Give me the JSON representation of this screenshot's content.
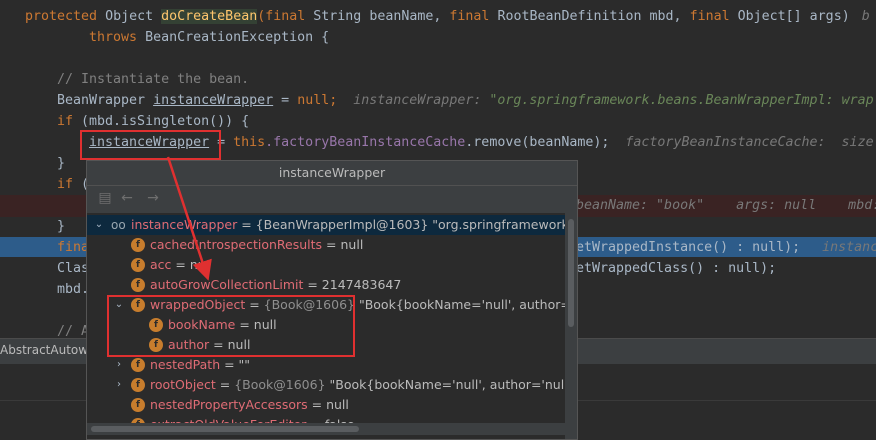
{
  "code": {
    "line1": {
      "kw": "protected",
      "type": "Object",
      "method": "doCreateBean",
      "params_a": "(final",
      "params_b": "String beanName,",
      "params_c": "final",
      "params_d": "RootBeanDefinition mbd,",
      "params_e": "final",
      "params_f": "Object[] args)",
      "trail": "b"
    },
    "line2": {
      "kw": "throws",
      "rest": "BeanCreationException {"
    },
    "line3": {
      "comment": "// Instantiate the bean."
    },
    "line4": {
      "code_a": "BeanWrapper",
      "code_b": "instanceWrapper",
      "code_c": " = ",
      "kw": "null",
      "code_d": ";",
      "hint_a": "instanceWrapper: ",
      "hint_b": "\"org.springframework.beans.BeanWrapperImpl: wrap"
    },
    "line5": {
      "kw": "if",
      "rest": " (mbd.isSingleton()) {"
    },
    "line6": {
      "var": "instanceWrapper",
      "eq": " = ",
      "kw": "this",
      "field": ".factoryBeanInstanceCache",
      "rest": ".remove(beanName);",
      "hint": "factoryBeanInstanceCache:  size"
    },
    "line7": {
      "text": "}"
    },
    "line8": {
      "kw": "if",
      "rest": " ("
    },
    "line9": {
      "hint": "beanName: \"book\"    args: null    mbd:"
    },
    "line10": {
      "text": "}"
    },
    "line11": {
      "start": "fina",
      "rest": "etWrappedInstance() : null);",
      "hint": "instance"
    },
    "line12": {
      "start": "Clas",
      "rest": "etWrappedClass() : null);"
    },
    "line13": {
      "start": "mbd."
    },
    "line14": {
      "start": "// A"
    }
  },
  "bottom_tab": "AbstractAutowi",
  "popup": {
    "title": "instanceWrapper",
    "rows": [
      {
        "name": "instanceWrapper",
        "eq": " = ",
        "value": "{BeanWrapperImpl@1603} \"org.springframework.beans"
      },
      {
        "name": "cachedIntrospectionResults",
        "eq": " = ",
        "value": "null"
      },
      {
        "name": "acc",
        "eq": " = ",
        "value": "nu"
      },
      {
        "name": "autoGrowCollectionLimit",
        "eq": " = ",
        "value": "2147483647"
      },
      {
        "name": "wrappedObject",
        "eq": " = ",
        "ref": "{Book@1606}",
        "value": " \"Book{bookName='null', author='null'}\""
      },
      {
        "name": "bookName",
        "eq": " = ",
        "value": "null"
      },
      {
        "name": "author",
        "eq": " = ",
        "value": "null"
      },
      {
        "name": "nestedPath",
        "eq": " = ",
        "value": "\"\""
      },
      {
        "name": "rootObject",
        "eq": " = ",
        "ref": "{Book@1606}",
        "value": " \"Book{bookName='null', author='null'}\""
      },
      {
        "name": "nestedPropertyAccessors",
        "eq": " = ",
        "value": "null"
      },
      {
        "name": "extractOldValueForEditor",
        "eq": " = ",
        "value": "false"
      }
    ]
  },
  "icons": {
    "field": "f",
    "object": "oo",
    "back": "←",
    "forward": "→",
    "expand": "›",
    "collapse": "⌄"
  },
  "colors": {
    "annotation_red": "#e03030",
    "field_icon": "#c77d2d",
    "selection": "#0d293e",
    "exec_line": "#2d5c8a"
  }
}
